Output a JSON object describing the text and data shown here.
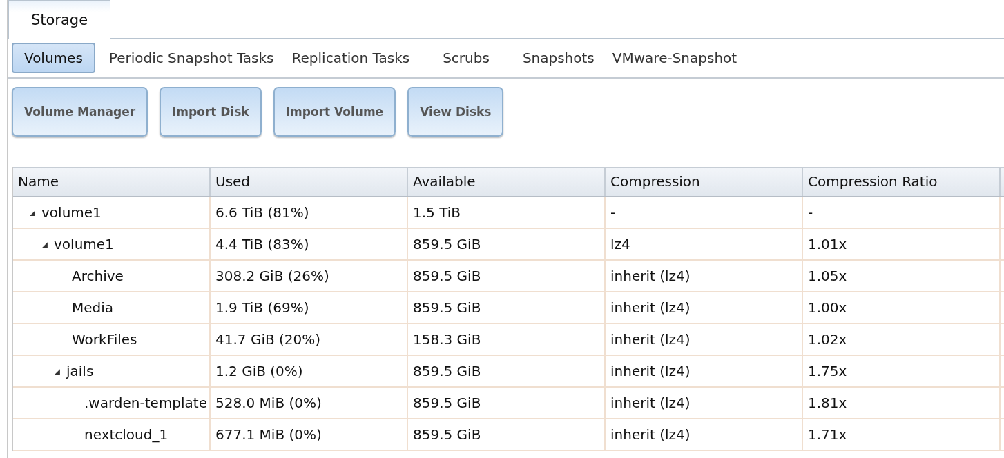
{
  "main_tabs": [
    {
      "label": "Storage",
      "selected": true
    }
  ],
  "sub_tabs": [
    {
      "label": "Volumes",
      "selected": true
    },
    {
      "label": "Periodic Snapshot Tasks",
      "selected": false
    },
    {
      "label": "Replication Tasks",
      "selected": false
    },
    {
      "label": "Scrubs",
      "selected": false
    },
    {
      "label": "Snapshots",
      "selected": false
    },
    {
      "label": "VMware-Snapshot",
      "selected": false
    }
  ],
  "buttons": [
    "Volume Manager",
    "Import Disk",
    "Import Volume",
    "View Disks"
  ],
  "table": {
    "columns": [
      "Name",
      "Used",
      "Available",
      "Compression",
      "Compression Ratio"
    ],
    "rows": [
      {
        "name": "volume1",
        "used": "6.6 TiB (81%)",
        "available": "1.5 TiB",
        "compression": "-",
        "ratio": "-",
        "expanded": true,
        "children": [
          {
            "name": "volume1",
            "used": "4.4 TiB (83%)",
            "available": "859.5 GiB",
            "compression": "lz4",
            "ratio": "1.01x",
            "expanded": true,
            "children": [
              {
                "name": "Archive",
                "used": "308.2 GiB (26%)",
                "available": "859.5 GiB",
                "compression": "inherit (lz4)",
                "ratio": "1.05x"
              },
              {
                "name": "Media",
                "used": "1.9 TiB (69%)",
                "available": "859.5 GiB",
                "compression": "inherit (lz4)",
                "ratio": "1.00x"
              },
              {
                "name": "WorkFiles",
                "used": "41.7 GiB (20%)",
                "available": "158.3 GiB",
                "compression": "inherit (lz4)",
                "ratio": "1.02x"
              },
              {
                "name": "jails",
                "used": "1.2 GiB (0%)",
                "available": "859.5 GiB",
                "compression": "inherit (lz4)",
                "ratio": "1.75x",
                "expanded": true,
                "children": [
                  {
                    "name": ".warden-template",
                    "used": "528.0 MiB (0%)",
                    "available": "859.5 GiB",
                    "compression": "inherit (lz4)",
                    "ratio": "1.81x"
                  },
                  {
                    "name": "nextcloud_1",
                    "used": "677.1 MiB (0%)",
                    "available": "859.5 GiB",
                    "compression": "inherit (lz4)",
                    "ratio": "1.71x"
                  }
                ]
              }
            ]
          }
        ]
      }
    ]
  }
}
